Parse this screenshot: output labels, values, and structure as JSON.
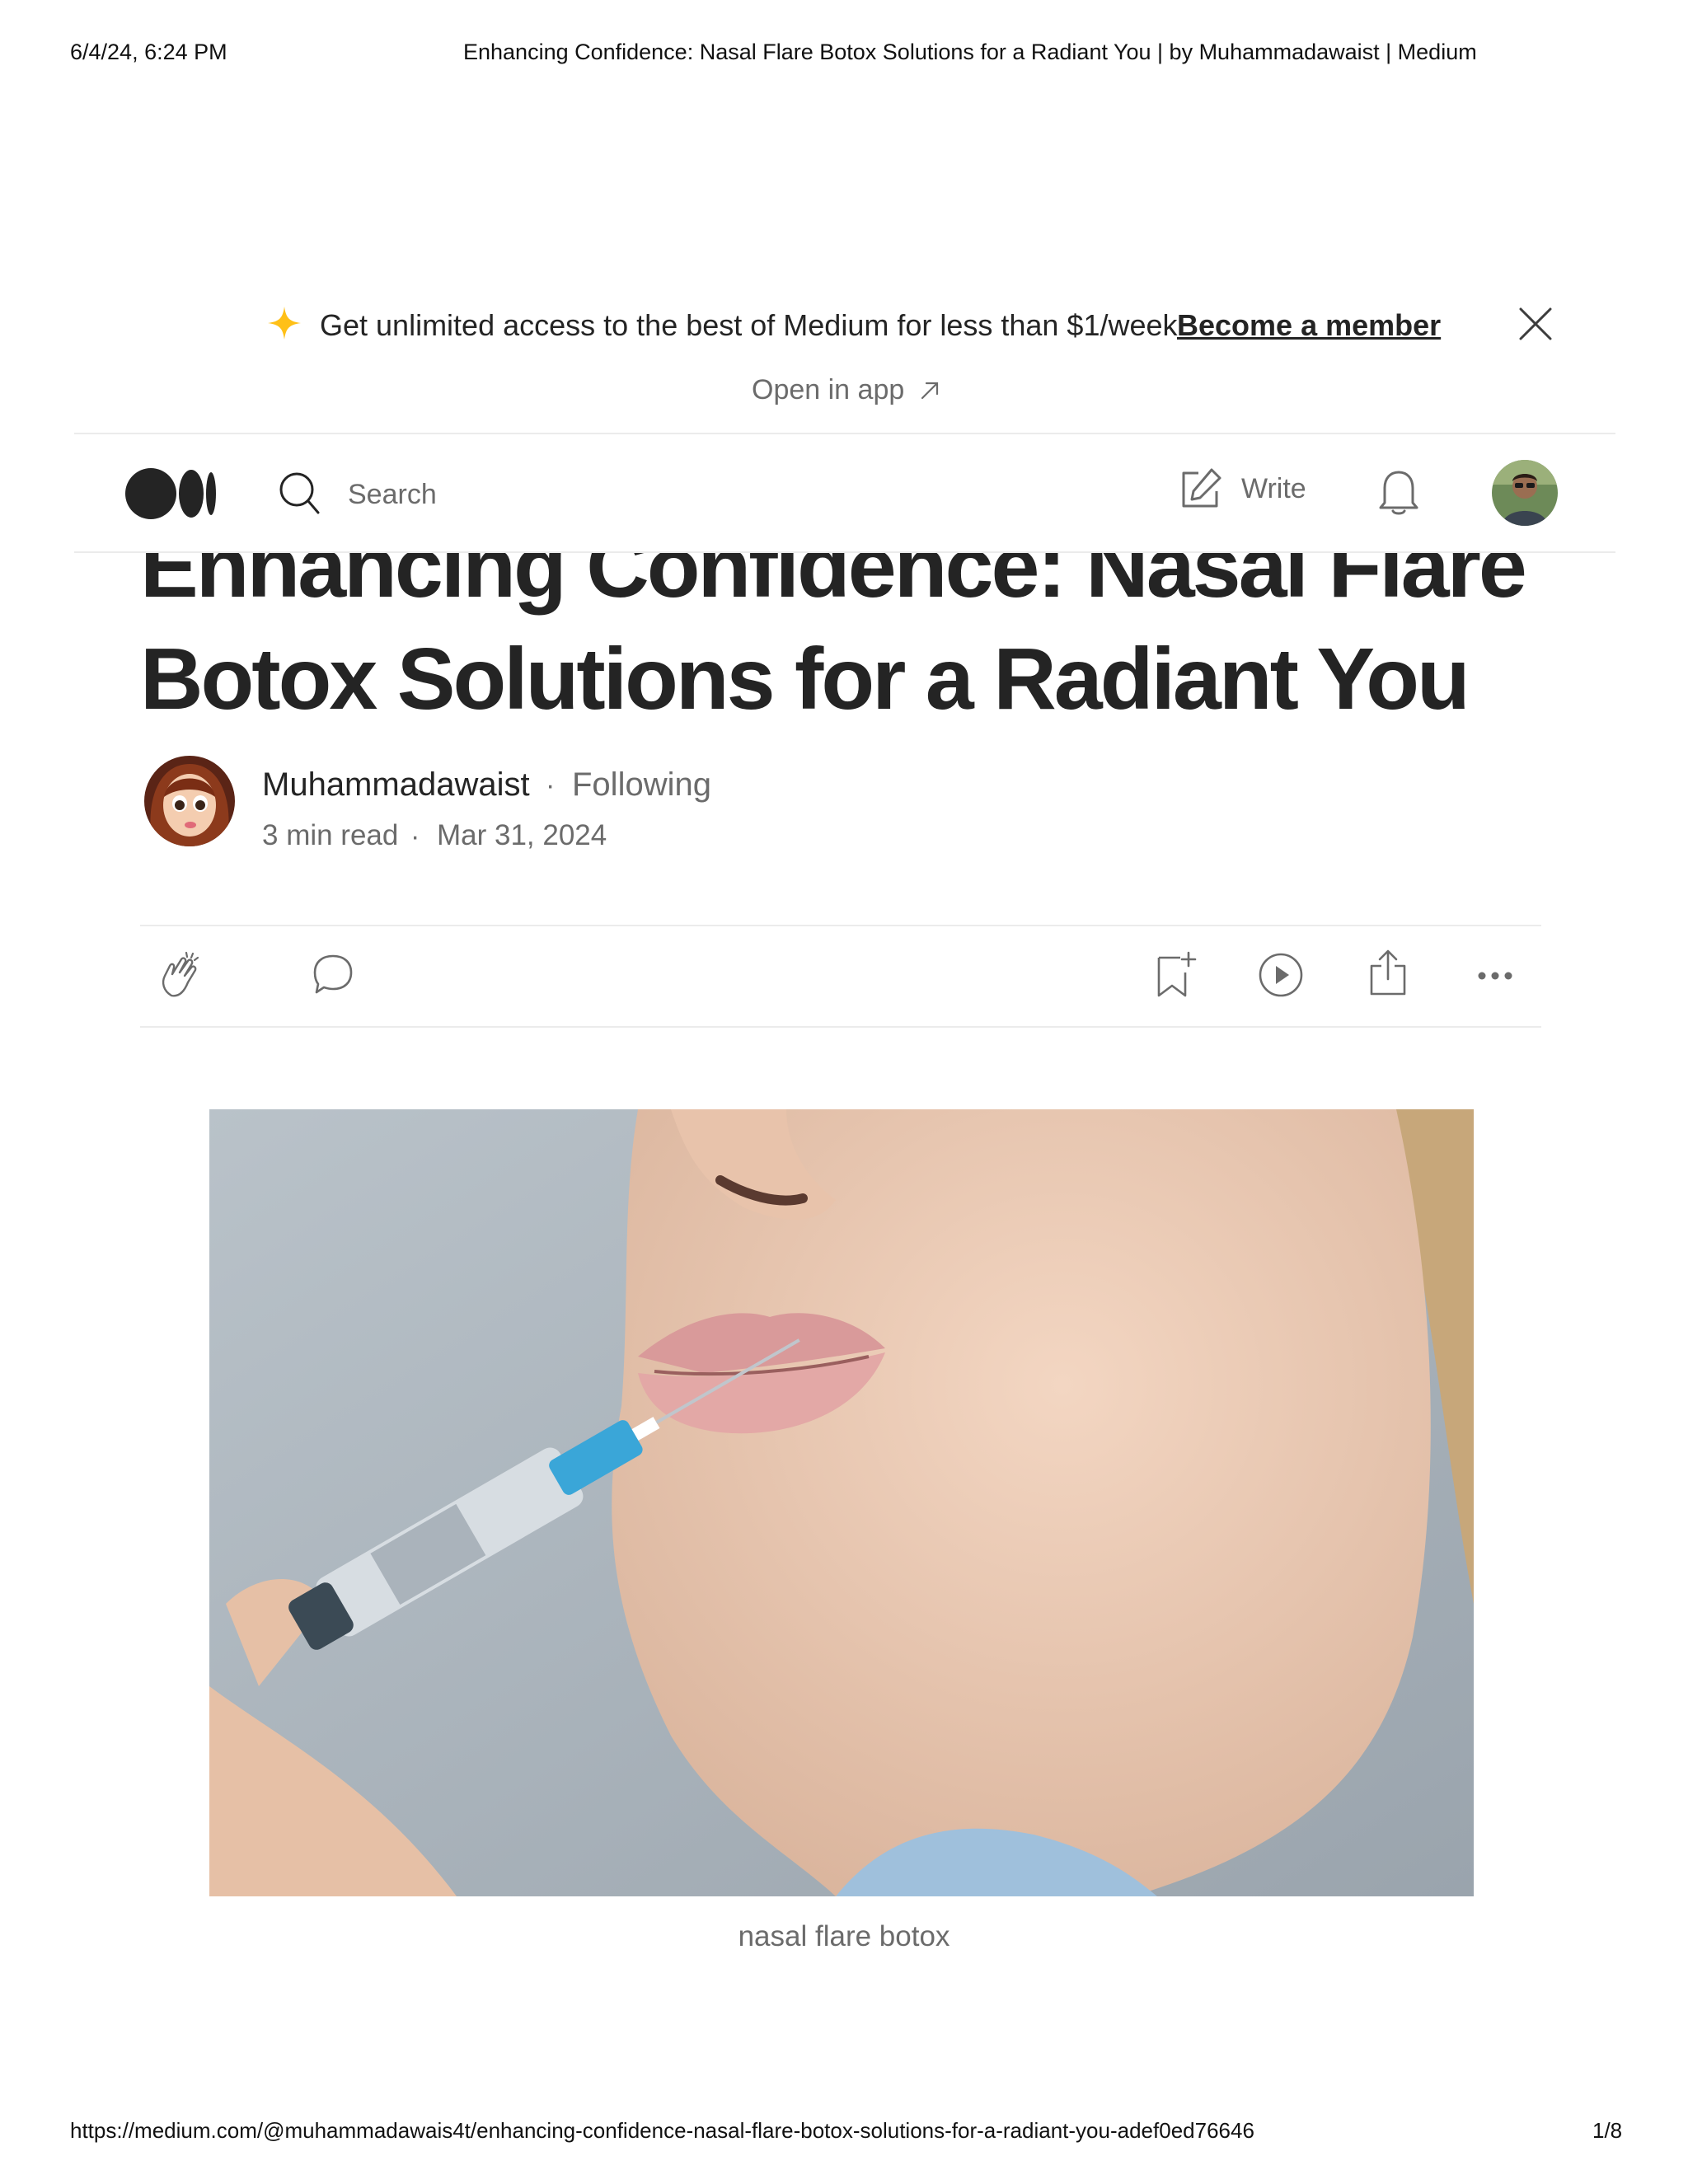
{
  "print": {
    "datetime": "6/4/24, 6:24 PM",
    "doc_title": "Enhancing Confidence: Nasal Flare Botox Solutions for a Radiant You | by Muhammadawaist | Medium",
    "url": "https://medium.com/@muhammadawais4t/enhancing-confidence-nasal-flare-botox-solutions-for-a-radiant-you-adef0ed76646",
    "page": "1/8"
  },
  "banner": {
    "text": "Get unlimited access to the best of Medium for less than $1/week.",
    "link": "Become a member",
    "open_app": "Open in app",
    "star_color": "#FFC017"
  },
  "nav": {
    "search_placeholder": "Search",
    "write_label": "Write"
  },
  "article": {
    "title": "Enhancing Confidence: Nasal Flare Botox Solutions for a Radiant You",
    "author": "Muhammadawaist",
    "follow_label": "Following",
    "separator": "·",
    "read_time": "3 min read",
    "date": "Mar 31, 2024",
    "image_caption": "nasal flare botox"
  },
  "actions": {
    "icons": [
      "clap-icon",
      "comment-icon",
      "bookmark-add-icon",
      "play-icon",
      "share-icon",
      "more-icon"
    ]
  },
  "colors": {
    "text": "#242424",
    "muted": "#6b6b6b",
    "divider": "#ebebeb"
  }
}
